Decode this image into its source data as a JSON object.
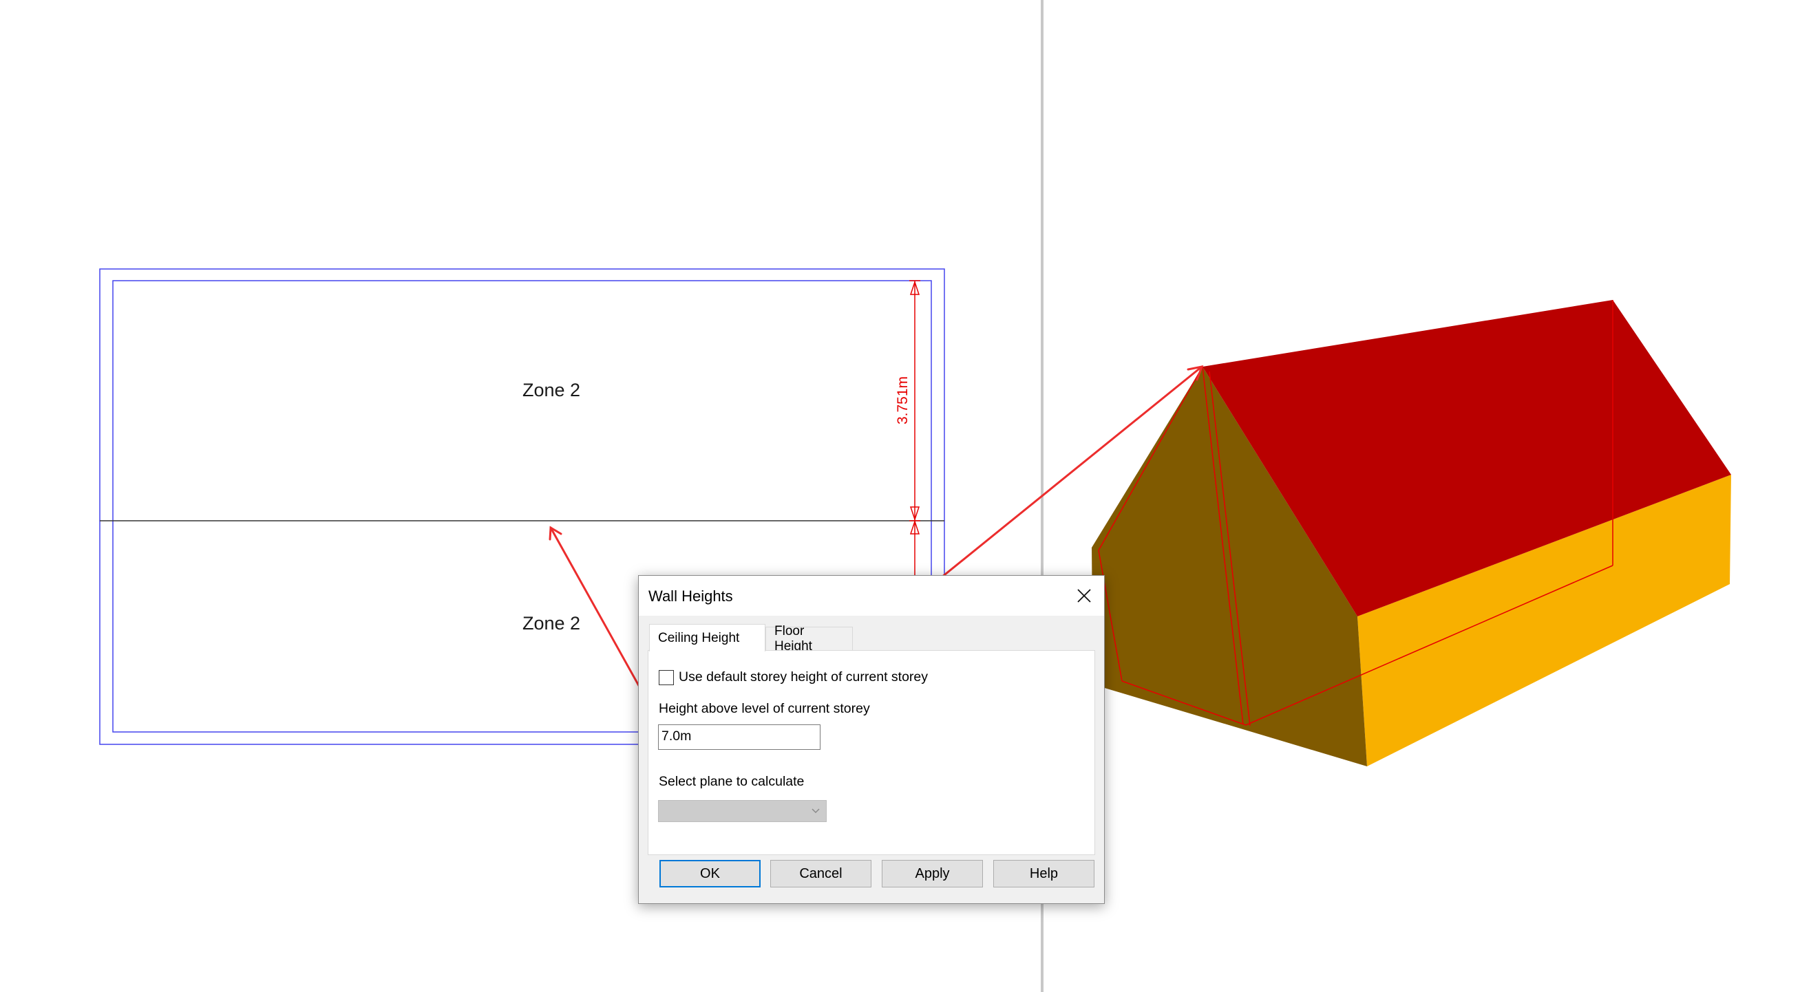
{
  "canvas": {
    "zone_top_label": "Zone 2",
    "zone_bottom_label": "Zone 2",
    "dimension_label": "3.751m"
  },
  "dialog": {
    "title": "Wall Heights",
    "close_icon": "close-icon",
    "tabs": [
      {
        "label": "Ceiling Height",
        "active": true
      },
      {
        "label": "Floor Height",
        "active": false
      }
    ],
    "use_default_checkbox": {
      "label": "Use default storey height of current storey",
      "checked": false
    },
    "height_label": "Height above level of current storey",
    "height_value": "7.0m",
    "plane_label": "Select plane to calculate",
    "plane_select": {
      "value": "",
      "enabled": false
    },
    "buttons": {
      "ok": "OK",
      "cancel": "Cancel",
      "apply": "Apply",
      "help": "Help"
    }
  },
  "colors": {
    "roof": "#b90000",
    "gable": "#805a00",
    "side_wall": "#f8b000",
    "annotation": "#e60000",
    "plan_outline": "#3a3aff"
  }
}
